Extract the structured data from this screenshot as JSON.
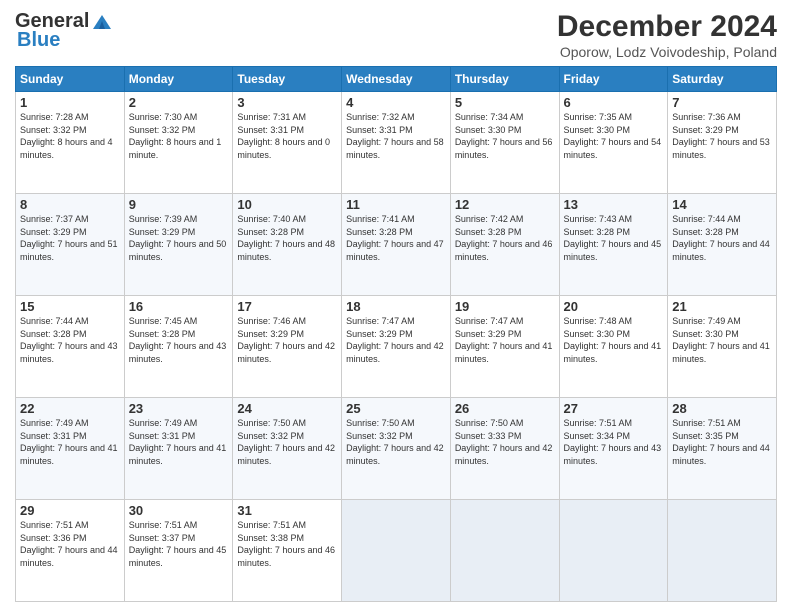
{
  "logo": {
    "line1": "General",
    "line2": "Blue"
  },
  "header": {
    "month_year": "December 2024",
    "location": "Oporow, Lodz Voivodeship, Poland"
  },
  "weekdays": [
    "Sunday",
    "Monday",
    "Tuesday",
    "Wednesday",
    "Thursday",
    "Friday",
    "Saturday"
  ],
  "weeks": [
    [
      {
        "day": 1,
        "sunrise": "7:28 AM",
        "sunset": "3:32 PM",
        "daylight": "8 hours and 4 minutes."
      },
      {
        "day": 2,
        "sunrise": "7:30 AM",
        "sunset": "3:32 PM",
        "daylight": "8 hours and 1 minute."
      },
      {
        "day": 3,
        "sunrise": "7:31 AM",
        "sunset": "3:31 PM",
        "daylight": "8 hours and 0 minutes."
      },
      {
        "day": 4,
        "sunrise": "7:32 AM",
        "sunset": "3:31 PM",
        "daylight": "7 hours and 58 minutes."
      },
      {
        "day": 5,
        "sunrise": "7:34 AM",
        "sunset": "3:30 PM",
        "daylight": "7 hours and 56 minutes."
      },
      {
        "day": 6,
        "sunrise": "7:35 AM",
        "sunset": "3:30 PM",
        "daylight": "7 hours and 54 minutes."
      },
      {
        "day": 7,
        "sunrise": "7:36 AM",
        "sunset": "3:29 PM",
        "daylight": "7 hours and 53 minutes."
      }
    ],
    [
      {
        "day": 8,
        "sunrise": "7:37 AM",
        "sunset": "3:29 PM",
        "daylight": "7 hours and 51 minutes."
      },
      {
        "day": 9,
        "sunrise": "7:39 AM",
        "sunset": "3:29 PM",
        "daylight": "7 hours and 50 minutes."
      },
      {
        "day": 10,
        "sunrise": "7:40 AM",
        "sunset": "3:28 PM",
        "daylight": "7 hours and 48 minutes."
      },
      {
        "day": 11,
        "sunrise": "7:41 AM",
        "sunset": "3:28 PM",
        "daylight": "7 hours and 47 minutes."
      },
      {
        "day": 12,
        "sunrise": "7:42 AM",
        "sunset": "3:28 PM",
        "daylight": "7 hours and 46 minutes."
      },
      {
        "day": 13,
        "sunrise": "7:43 AM",
        "sunset": "3:28 PM",
        "daylight": "7 hours and 45 minutes."
      },
      {
        "day": 14,
        "sunrise": "7:44 AM",
        "sunset": "3:28 PM",
        "daylight": "7 hours and 44 minutes."
      }
    ],
    [
      {
        "day": 15,
        "sunrise": "7:44 AM",
        "sunset": "3:28 PM",
        "daylight": "7 hours and 43 minutes."
      },
      {
        "day": 16,
        "sunrise": "7:45 AM",
        "sunset": "3:28 PM",
        "daylight": "7 hours and 43 minutes."
      },
      {
        "day": 17,
        "sunrise": "7:46 AM",
        "sunset": "3:29 PM",
        "daylight": "7 hours and 42 minutes."
      },
      {
        "day": 18,
        "sunrise": "7:47 AM",
        "sunset": "3:29 PM",
        "daylight": "7 hours and 42 minutes."
      },
      {
        "day": 19,
        "sunrise": "7:47 AM",
        "sunset": "3:29 PM",
        "daylight": "7 hours and 41 minutes."
      },
      {
        "day": 20,
        "sunrise": "7:48 AM",
        "sunset": "3:30 PM",
        "daylight": "7 hours and 41 minutes."
      },
      {
        "day": 21,
        "sunrise": "7:49 AM",
        "sunset": "3:30 PM",
        "daylight": "7 hours and 41 minutes."
      }
    ],
    [
      {
        "day": 22,
        "sunrise": "7:49 AM",
        "sunset": "3:31 PM",
        "daylight": "7 hours and 41 minutes."
      },
      {
        "day": 23,
        "sunrise": "7:49 AM",
        "sunset": "3:31 PM",
        "daylight": "7 hours and 41 minutes."
      },
      {
        "day": 24,
        "sunrise": "7:50 AM",
        "sunset": "3:32 PM",
        "daylight": "7 hours and 42 minutes."
      },
      {
        "day": 25,
        "sunrise": "7:50 AM",
        "sunset": "3:32 PM",
        "daylight": "7 hours and 42 minutes."
      },
      {
        "day": 26,
        "sunrise": "7:50 AM",
        "sunset": "3:33 PM",
        "daylight": "7 hours and 42 minutes."
      },
      {
        "day": 27,
        "sunrise": "7:51 AM",
        "sunset": "3:34 PM",
        "daylight": "7 hours and 43 minutes."
      },
      {
        "day": 28,
        "sunrise": "7:51 AM",
        "sunset": "3:35 PM",
        "daylight": "7 hours and 44 minutes."
      }
    ],
    [
      {
        "day": 29,
        "sunrise": "7:51 AM",
        "sunset": "3:36 PM",
        "daylight": "7 hours and 44 minutes."
      },
      {
        "day": 30,
        "sunrise": "7:51 AM",
        "sunset": "3:37 PM",
        "daylight": "7 hours and 45 minutes."
      },
      {
        "day": 31,
        "sunrise": "7:51 AM",
        "sunset": "3:38 PM",
        "daylight": "7 hours and 46 minutes."
      },
      null,
      null,
      null,
      null
    ]
  ]
}
